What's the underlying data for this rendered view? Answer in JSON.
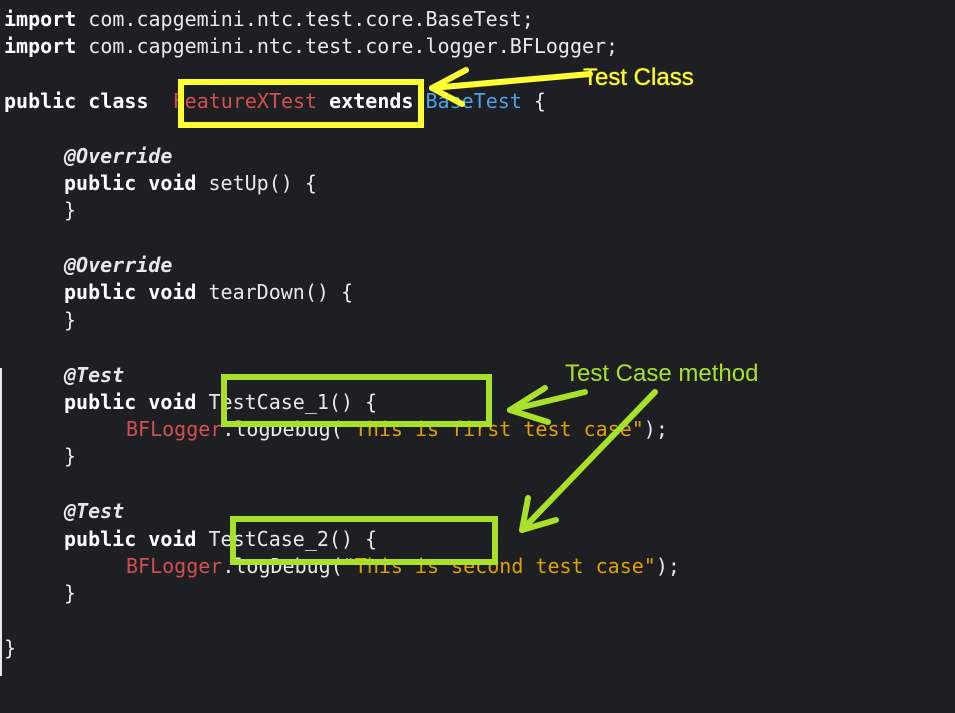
{
  "code": {
    "import1_kw": "import",
    "import1_path": "com.capgemini.ntc.test.core.BaseTest;",
    "import2_kw": "import",
    "import2_path": "com.capgemini.ntc.test.core.logger.BFLogger;",
    "class_public": "public",
    "class_kw": "class",
    "class_name": "FeatureXTest",
    "extends_kw": "extends",
    "base_class": "BaseTest",
    "open_brace": "{",
    "override_annotation": "@Override",
    "setup_decl_kw": "public void",
    "setup_name": "setUp() {",
    "close_brace": "}",
    "teardown_decl_kw": "public void",
    "teardown_name": "tearDown() {",
    "test_annotation": "@Test",
    "tc1_decl_kw": "public void",
    "tc1_name": "TestCase_1() {",
    "tc1_log_class": "BFLogger",
    "tc1_log_call": ".logDebug(",
    "tc1_log_string": "\"This is first test case\"",
    "tc1_log_end": ");",
    "tc2_decl_kw": "public void",
    "tc2_name": "TestCase_2() {",
    "tc2_log_class": "BFLogger",
    "tc2_log_call": ".logDebug(",
    "tc2_log_string": "\"This is second test case\"",
    "tc2_log_end": ");"
  },
  "annotations": {
    "test_class_label": "Test Class",
    "test_case_method_label": "Test Case method"
  },
  "colors": {
    "background": "#1e1f22",
    "class_name": "#d05050",
    "base_class": "#4aa3e6",
    "string": "#e0a000",
    "highlight_yellow": "#ffff33",
    "highlight_green": "#a8e02a"
  }
}
